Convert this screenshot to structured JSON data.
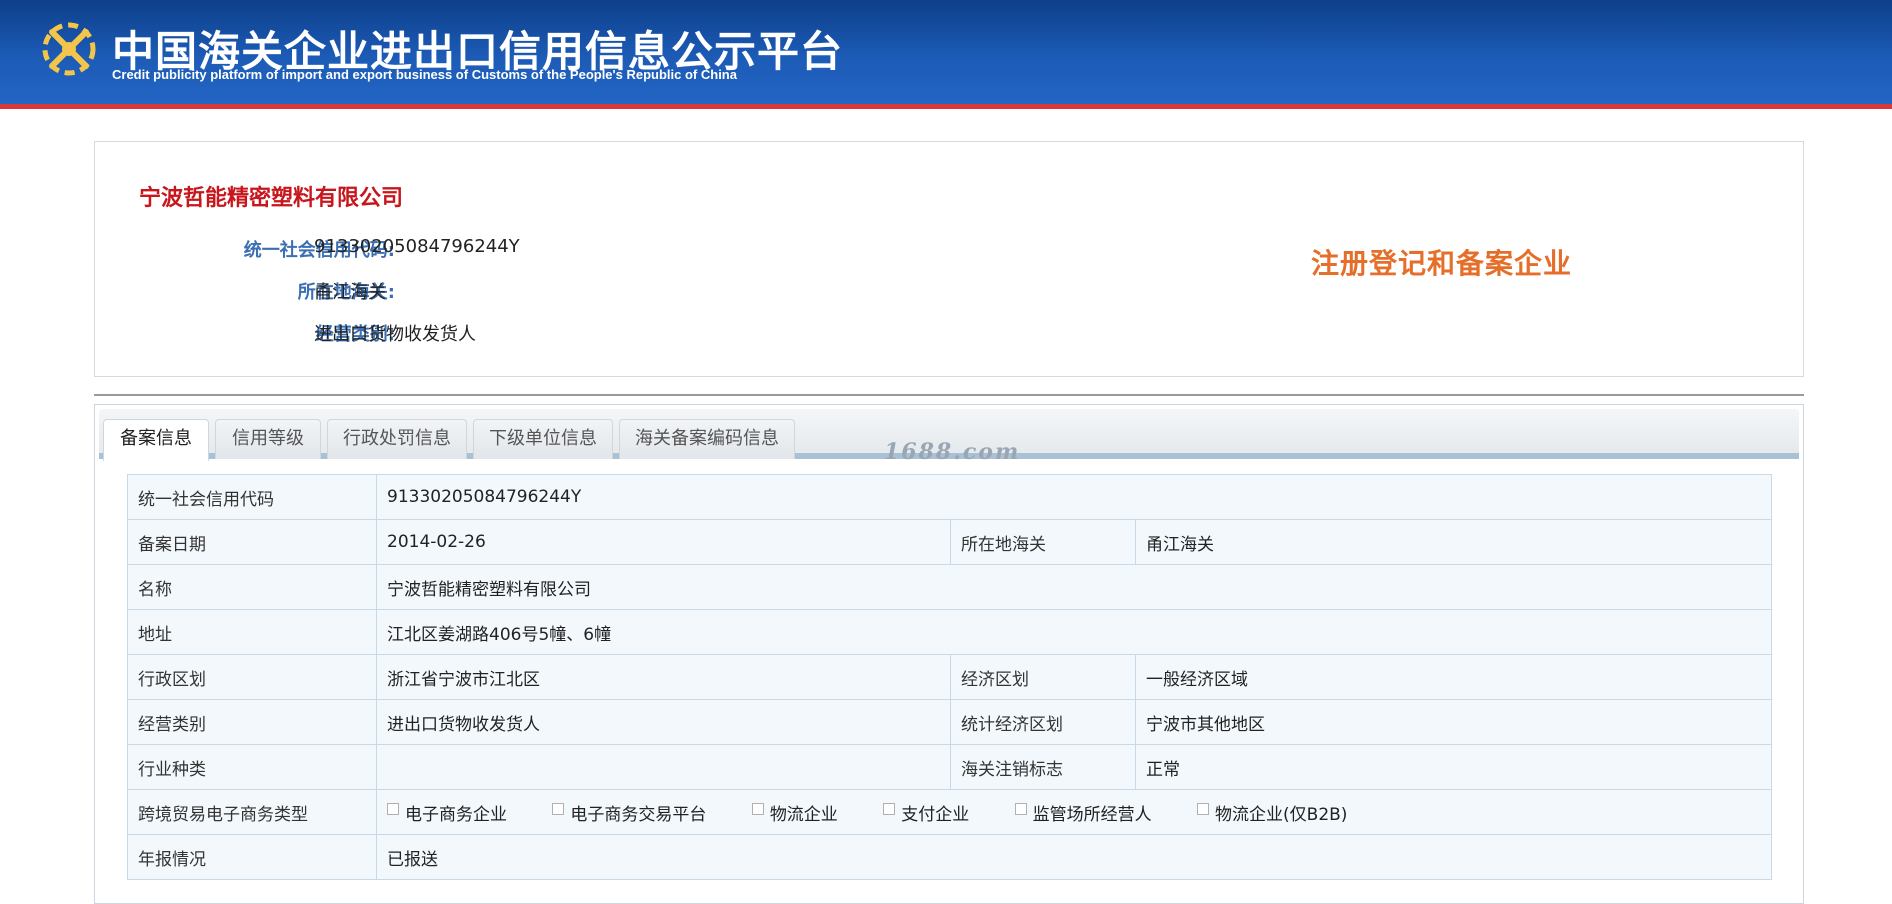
{
  "header": {
    "title": "中国海关企业进出口信用信息公示平台",
    "subtitle": "Credit publicity platform of import and export business of Customs of the People's Republic of China",
    "logo_icon": "customs-emblem-icon"
  },
  "company": {
    "name": "宁波哲能精密塑料有限公司",
    "status": "注册登记和备案企业",
    "fields": [
      {
        "label": "统一社会信用代码:",
        "value": "91330205084796244Y"
      },
      {
        "label": "所在地海关:",
        "value": "甬江海关"
      },
      {
        "label": "经营类别:",
        "value": "进出口货物收发货人"
      }
    ]
  },
  "tabs": [
    {
      "label": "备案信息",
      "active": true
    },
    {
      "label": "信用等级",
      "active": false
    },
    {
      "label": "行政处罚信息",
      "active": false
    },
    {
      "label": "下级单位信息",
      "active": false
    },
    {
      "label": "海关备案编码信息",
      "active": false
    }
  ],
  "watermark": "1688.com",
  "record": {
    "credit_code_label": "统一社会信用代码",
    "credit_code": "91330205084796244Y",
    "date_label": "备案日期",
    "date": "2014-02-26",
    "customs_label": "所在地海关",
    "customs": "甬江海关",
    "name_label": "名称",
    "name": "宁波哲能精密塑料有限公司",
    "address_label": "地址",
    "address": "江北区姜湖路406号5幢、6幢",
    "admin_region_label": "行政区划",
    "admin_region": "浙江省宁波市江北区",
    "econ_zone_label": "经济区划",
    "econ_zone": "一般经济区域",
    "business_type_label": "经营类别",
    "business_type": "进出口货物收发货人",
    "stat_zone_label": "统计经济区划",
    "stat_zone": "宁波市其他地区",
    "industry_label": "行业种类",
    "industry": "",
    "cancel_flag_label": "海关注销标志",
    "cancel_flag": "正常",
    "ecommerce_label": "跨境贸易电子商务类型",
    "ecommerce_options": [
      "电子商务企业",
      "电子商务交易平台",
      "物流企业",
      "支付企业",
      "监管场所经营人",
      "物流企业(仅B2B)"
    ],
    "annual_report_label": "年报情况",
    "annual_report": "已报送"
  },
  "colors": {
    "banner": "#1c5bb6",
    "banner_line": "#d9383b",
    "company_name": "#c8161d",
    "label_blue": "#3c6fb2",
    "status_orange": "#e56f2a",
    "table_bg": "#f2f8fc",
    "table_border": "#c8d9e8"
  }
}
